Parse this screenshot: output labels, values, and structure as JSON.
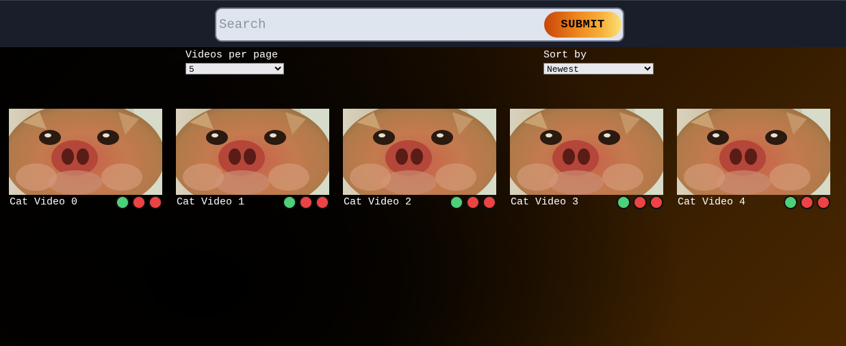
{
  "search": {
    "placeholder": "Search",
    "value": "",
    "submit_label": "SUBMIT"
  },
  "controls": {
    "per_page_label": "Videos per page",
    "per_page_value": "5",
    "sort_label": "Sort by",
    "sort_value": "Newest"
  },
  "colors": {
    "topbar": "#1a1e2b",
    "search_bg": "#dfe5ef",
    "submit_gradient_start": "#c94508",
    "submit_gradient_end": "#fbe07a",
    "green_dot": "#4ed07a",
    "red_dot": "#ec4444"
  },
  "videos": [
    {
      "title": "Cat Video 0",
      "thumbnail": "cat-closeup-thumbnail"
    },
    {
      "title": "Cat Video 1",
      "thumbnail": "cat-closeup-thumbnail"
    },
    {
      "title": "Cat Video 2",
      "thumbnail": "cat-closeup-thumbnail"
    },
    {
      "title": "Cat Video 3",
      "thumbnail": "cat-closeup-thumbnail"
    },
    {
      "title": "Cat Video 4",
      "thumbnail": "cat-closeup-thumbnail"
    }
  ],
  "dot_icons": [
    "green-circle-icon",
    "red-circle-icon",
    "red-circle-icon"
  ]
}
